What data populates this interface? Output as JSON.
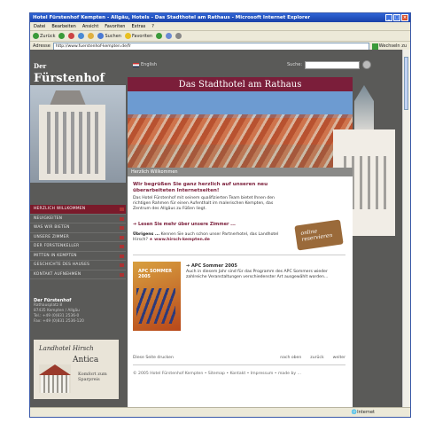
{
  "window": {
    "title": "Hotel Fürstenhof Kempten - Allgäu, Hotels - Das Stadthotel am Rathaus - Microsoft Internet Explorer",
    "menu": [
      "Datei",
      "Bearbeiten",
      "Ansicht",
      "Favoriten",
      "Extras",
      "?"
    ],
    "toolbar": {
      "back": "Zurück",
      "search": "Suchen",
      "favorites": "Favoriten"
    },
    "address_label": "Adresse",
    "url": "http://www.fuerstenhof-kempten.de/fr",
    "go": "Wechseln zu",
    "status": "Internet"
  },
  "site": {
    "logo_der": "Der",
    "logo_name": "Fürstenhof",
    "lang": "English",
    "search_label": "Suche:",
    "banner": "Das Stadthotel am Rathaus",
    "nav": [
      "HERZLICH WILLKOMMEN",
      "NEUIGKEITEN",
      "WAS WIR BIETEN",
      "UNSERE ZIMMER",
      "DER FÜRSTENKELLER",
      "MITTEN IN KEMPTEN",
      "GESCHICHTE DES HAUSES",
      "KONTAKT AUFNEHMEN"
    ],
    "contact": {
      "name": "Der Fürstenhof",
      "street": "Rathausplatz 8",
      "city": "87435 Kempten / Allgäu",
      "tel": "Tel.: +49 (0)831 2536-0",
      "fax": "Fax: +49 (0)831 2536-120"
    },
    "antica": {
      "t1": "Landhotel Hirsch",
      "t2": "Antica",
      "t3": "Komfort zum Sparpreis"
    },
    "greet": "Herzlich Willkommen",
    "headline": "Wir begrüßen Sie ganz herzlich auf unseren neu überarbeiteten Internetseiten!",
    "intro": "Das Hotel Fürstenhof mit seinem qualifizierten Team bietet Ihnen den richtigen Rahmen für einen Aufenthalt im malerischen Kempten, das Zentrum des Allgäus zu Füßen liegt.",
    "more": "Lesen Sie mehr über unsere Zimmer ...",
    "uebrigens_b": "Übrigens ...",
    "uebrigens": "Kennen Sie auch schon unser Partnerhotel, das Landhotel Hirsch?",
    "hirsch_link": "www.hirsch-kempten.de",
    "suitcase": "online reservieren",
    "apc_badge": "APC SOMMER 2005",
    "apc_title": "APC Sommer 2005",
    "apc_text": "Auch in diesem Jahr sind für das Programm des APC Sommers wieder zahlreiche Veranstaltungen verschiedenster Art ausgewählt worden...",
    "footer": {
      "print": "Diese Seite drucken",
      "top": "nach oben",
      "back": "zurück",
      "next": "weiter"
    },
    "copyright": "© 2005 Hotel Fürstenhof Kempten • Sitemap • Kontakt • Impressum • made by ..."
  }
}
